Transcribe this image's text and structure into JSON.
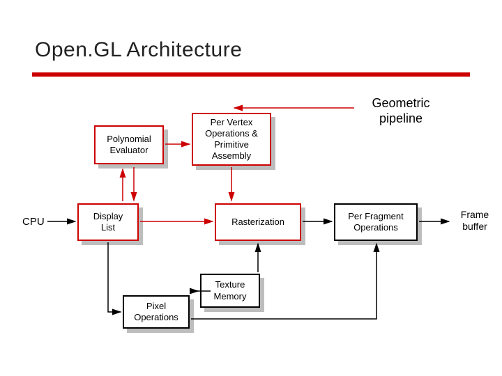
{
  "title": "Open.GL Architecture",
  "labels": {
    "cpu": "CPU",
    "frame_buffer": "Frame\nbuffer",
    "geometric_pipeline": "Geometric\npipeline"
  },
  "boxes": {
    "polynomial_evaluator": "Polynomial\nEvaluator",
    "per_vertex": "Per Vertex\nOperations &\nPrimitive\nAssembly",
    "display_list": "Display\nList",
    "rasterization": "Rasterization",
    "per_fragment": "Per Fragment\nOperations",
    "texture_memory": "Texture\nMemory",
    "pixel_operations": "Pixel\nOperations"
  },
  "colors": {
    "accent": "#cc0000",
    "shadow": "#bdbdbd"
  }
}
